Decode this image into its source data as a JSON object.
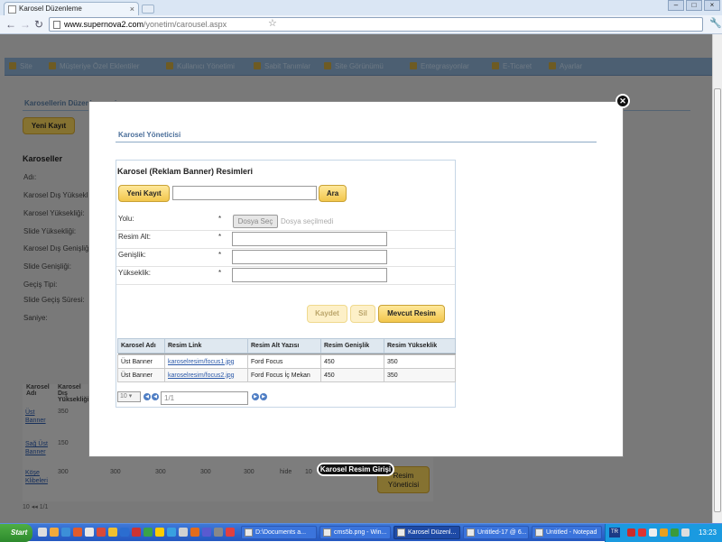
{
  "browser": {
    "tab_title": "Karosel Düzenleme",
    "url_host": "www.supernova2.com",
    "url_path": "/yonetim/carousel.aspx"
  },
  "menu": {
    "items": [
      "Site",
      "Müşteriye Özel Eklentiler",
      "Kullanıcı Yönetimi",
      "Sabit Tanımlar",
      "Site Görünümü",
      "Entegrasyonlar",
      "E-Ticaret",
      "Ayarlar"
    ]
  },
  "background": {
    "title": "Karosellerin Düzenlenmesi",
    "new_button": "Yeni Kayıt",
    "section_title": "Karoseller",
    "labels": [
      "Adı:",
      "Karosel Dış Yüksekliği:",
      "Karosel Yüksekliği:",
      "Slide Yüksekliği:",
      "Karosel Dış Genişliği:",
      "Slide Genişliği:",
      "Geçiş Tipi:",
      "Slide Geçiş Süresi:",
      "Saniye:"
    ],
    "table_headers": [
      "Karosel Adı",
      "Karosel Dış Yüksekliği"
    ],
    "rows": [
      {
        "name": "Üst Banner",
        "value": "350"
      },
      {
        "name": "Sağ Üst Banner",
        "value": "150"
      },
      {
        "name": "Köşe Klibeleri",
        "value": "300"
      }
    ],
    "row3_extra": [
      "300",
      "300",
      "300",
      "300",
      "300",
      "hide",
      "10"
    ],
    "karosel_button": "Resim Yöneticisi",
    "pager_size": "10",
    "pager_page": "1/1"
  },
  "modal": {
    "title": "Karosel Yöneticisi",
    "panel_title": "Karosel (Reklam Banner) Resimleri",
    "new_button": "Yeni Kayıt",
    "search_value": "",
    "search_button": "Ara",
    "required_mark": "*",
    "fields": {
      "path_label": "Yolu:",
      "file_button": "Dosya Seç",
      "file_status": "Dosya seçilmedi",
      "alt_label": "Resim Alt:",
      "width_label": "Genişlik:",
      "height_label": "Yükseklik:"
    },
    "buttons": {
      "save": "Kaydet",
      "delete": "Sil",
      "current": "Mevcut Resim"
    },
    "table": {
      "headers": [
        "Karosel Adı",
        "Resim Link",
        "Resim Alt Yazısı",
        "Resim Genişlik",
        "Resim Yükseklik"
      ],
      "rows": [
        [
          "Üst Banner",
          "karoselresim/focus1.jpg",
          "Ford Focus",
          "450",
          "350"
        ],
        [
          "Üst Banner",
          "karoselresim/focus2.jpg",
          "Ford Focus İç Mekan",
          "450",
          "350"
        ]
      ]
    },
    "pager": {
      "size": "10",
      "page": "1/1"
    },
    "close_icon": "close-icon"
  },
  "tooltip": "Karosel Resim Girişi",
  "taskbar": {
    "start": "Start",
    "tasks": [
      "D:\\Documents a...",
      "cms5b.png - Win...",
      "Karosel Düzenl...",
      "Untitled-17 @ 6...",
      "Untitled - Notepad"
    ],
    "lang": "TR",
    "clock": "13:23"
  }
}
